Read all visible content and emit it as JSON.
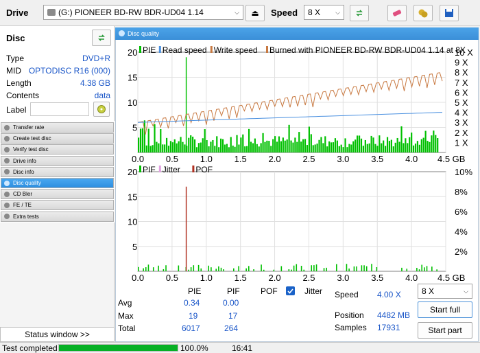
{
  "toolbar": {
    "drive_label": "Drive",
    "drive_value": "(G:)   PIONEER BD-RW   BDR-UD04 1.14",
    "speed_label": "Speed",
    "speed_value": "8 X"
  },
  "disc": {
    "header": "Disc",
    "rows": [
      {
        "k": "Type",
        "v": "DVD+R"
      },
      {
        "k": "MID",
        "v": "OPTODISC R16 (000)"
      },
      {
        "k": "Length",
        "v": "4.38 GB"
      },
      {
        "k": "Contents",
        "v": "data"
      }
    ],
    "label_key": "Label"
  },
  "nav": {
    "items": [
      {
        "label": "Transfer rate",
        "name": "nav-transfer-rate"
      },
      {
        "label": "Create test disc",
        "name": "nav-create-test-disc"
      },
      {
        "label": "Verify test disc",
        "name": "nav-verify-test-disc"
      },
      {
        "label": "Drive info",
        "name": "nav-drive-info"
      },
      {
        "label": "Disc info",
        "name": "nav-disc-info"
      },
      {
        "label": "Disc quality",
        "name": "nav-disc-quality"
      },
      {
        "label": "CD Bler",
        "name": "nav-cd-bler"
      },
      {
        "label": "FE / TE",
        "name": "nav-fe-te"
      },
      {
        "label": "Extra tests",
        "name": "nav-extra-tests"
      }
    ],
    "active_index": 5,
    "status_window": "Status window >>"
  },
  "panel": {
    "title": "Disc quality"
  },
  "chart_data": [
    {
      "type": "bar",
      "legend": [
        "PIE",
        "Read speed",
        "Write speed",
        "Burned with PIONEER BD-RW   BDR-UD04 1.14 at 8X"
      ],
      "x_ticks": [
        "0.0",
        "0.5",
        "1.0",
        "1.5",
        "2.0",
        "2.5",
        "3.0",
        "3.5",
        "4.0",
        "4.5 GB"
      ],
      "y_left_ticks": [
        "20",
        "15",
        "10",
        "5"
      ],
      "y_right_ticks": [
        "10 X",
        "9 X",
        "8 X",
        "7 X",
        "6 X",
        "5 X",
        "4 X",
        "3 X",
        "2 X",
        "1 X"
      ],
      "xlim": [
        0,
        4.5
      ],
      "ylim": [
        0,
        20
      ],
      "y2lim": [
        0,
        10
      ],
      "colors": {
        "pie": "#00c000",
        "read": "#4a90e0",
        "write": "#c87941"
      },
      "pie_max": 19,
      "pie_max_x": 0.7,
      "read_speed_start": 3.0,
      "read_speed_end": 4.0,
      "write_speed_start": 3.0,
      "write_speed_end": 8.0
    },
    {
      "type": "bar",
      "legend": [
        "PIF",
        "Jitter",
        "POF"
      ],
      "x_ticks": [
        "0.0",
        "0.5",
        "1.0",
        "1.5",
        "2.0",
        "2.5",
        "3.0",
        "3.5",
        "4.0",
        "4.5 GB"
      ],
      "y_left_ticks": [
        "20",
        "15",
        "10",
        "5"
      ],
      "y_right_ticks": [
        "10%",
        "8%",
        "6%",
        "4%",
        "2%"
      ],
      "xlim": [
        0,
        4.5
      ],
      "ylim": [
        0,
        20
      ],
      "y2lim": [
        0,
        10
      ],
      "colors": {
        "pif": "#00c000",
        "jitter": "#e0a0e0",
        "spike": "#b03020"
      },
      "pif_max": 17,
      "pif_max_x": 0.7
    }
  ],
  "stats": {
    "headers": [
      "PIE",
      "PIF",
      "POF"
    ],
    "jitter_label": "Jitter",
    "jitter_checked": true,
    "rows": [
      {
        "k": "Avg",
        "pie": "0.34",
        "pif": "0.00"
      },
      {
        "k": "Max",
        "pie": "19",
        "pif": "17"
      },
      {
        "k": "Total",
        "pie": "6017",
        "pif": "264"
      }
    ],
    "speed_label": "Speed",
    "speed_value": "4.00 X",
    "position_label": "Position",
    "position_value": "4482 MB",
    "samples_label": "Samples",
    "samples_value": "17931",
    "speed_select": "8 X",
    "start_full": "Start full",
    "start_part": "Start part"
  },
  "statusbar": {
    "text": "Test completed",
    "progress": 100.0,
    "progress_text": "100.0%",
    "time": "16:41"
  }
}
